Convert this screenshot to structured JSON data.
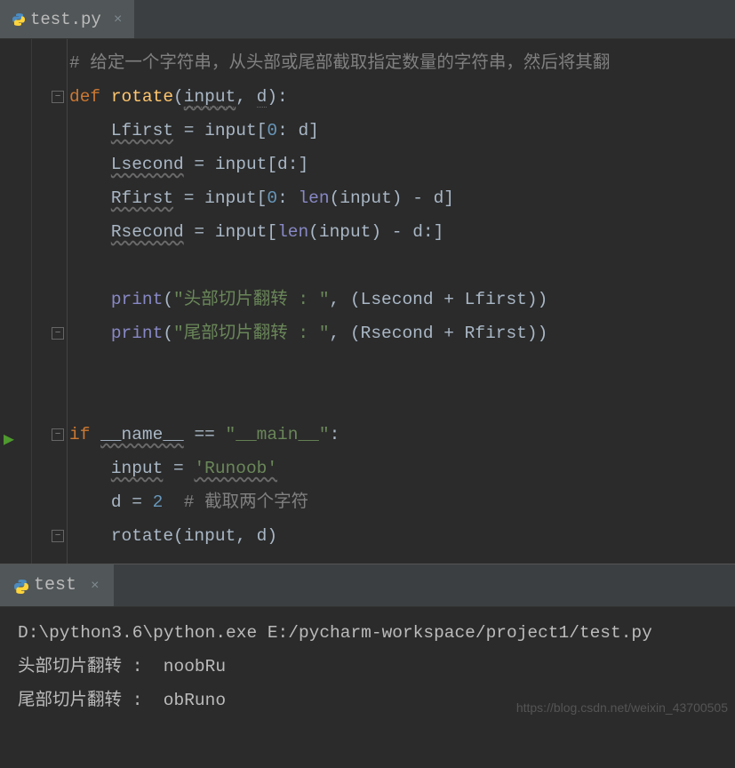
{
  "tab": {
    "filename": "test.py"
  },
  "code": {
    "comment_top": "# 给定一个字符串，从头部或尾部截取指定数量的字符串，然后将其翻",
    "kw_def": "def",
    "fn_name": "rotate",
    "param_input": "input",
    "param_d": "d",
    "v_Lfirst": "Lfirst",
    "v_Lsecond": "Lsecond",
    "v_Rfirst": "Rfirst",
    "v_Rsecond": "Rsecond",
    "kw_input": "input",
    "num0": "0",
    "bl_len": "len",
    "bl_print": "print",
    "str_head": "\"头部切片翻转 : \"",
    "str_tail": "\"尾部切片翻转 : \"",
    "kw_if": "if",
    "dunder_name": "__name__",
    "str_main": "\"__main__\"",
    "str_runoob": "'Runoob'",
    "num2": "2",
    "comment_d": "# 截取两个字符",
    "call_rotate": "rotate"
  },
  "terminal": {
    "tab_label": "test",
    "line1": "D:\\python3.6\\python.exe E:/pycharm-workspace/project1/test.py",
    "line2": "头部切片翻转 :  noobRu",
    "line3": "尾部切片翻转 :  obRuno"
  },
  "watermark": "https://blog.csdn.net/weixin_43700505"
}
